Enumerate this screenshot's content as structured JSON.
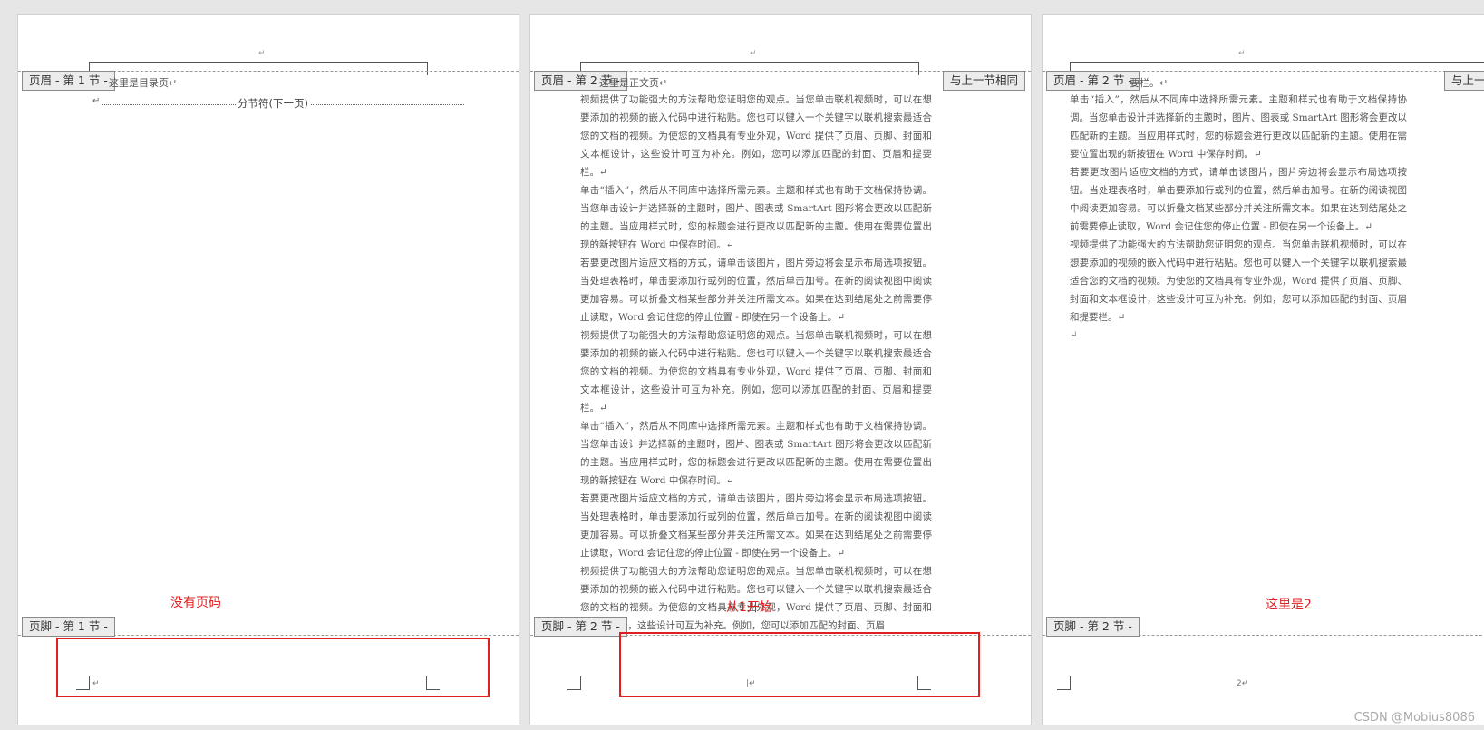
{
  "pages": [
    {
      "header_tag": "页眉 - 第 1 节 -",
      "intro": "这里是目录页↵",
      "section_break": "分节符(下一页)",
      "footer_tag": "页脚 - 第 1 节 -",
      "annotation": "没有页码"
    },
    {
      "header_tag": "页眉 - 第 2 节 -",
      "link_tag": "与上一节相同",
      "intro": "这里是正文页↵",
      "footer_tag": "页脚 - 第 2 节 -",
      "annotation": "从1开始",
      "paragraphs": [
        "视频提供了功能强大的方法帮助您证明您的观点。当您单击联机视频时，可以在想要添加的视频的嵌入代码中进行粘贴。您也可以键入一个关键字以联机搜索最适合您的文档的视频。为使您的文档具有专业外观，Word 提供了页眉、页脚、封面和文本框设计，这些设计可互为补充。例如，您可以添加匹配的封面、页眉和提要栏。↵",
        "单击“插入”，然后从不同库中选择所需元素。主题和样式也有助于文档保持协调。当您单击设计并选择新的主题时，图片、图表或 SmartArt 图形将会更改以匹配新的主题。当应用样式时，您的标题会进行更改以匹配新的主题。使用在需要位置出现的新按钮在 Word 中保存时间。↵",
        "若要更改图片适应文档的方式，请单击该图片，图片旁边将会显示布局选项按钮。当处理表格时，单击要添加行或列的位置，然后单击加号。在新的阅读视图中阅读更加容易。可以折叠文档某些部分并关注所需文本。如果在达到结尾处之前需要停止读取，Word 会记住您的停止位置 - 即使在另一个设备上。↵",
        "视频提供了功能强大的方法帮助您证明您的观点。当您单击联机视频时，可以在想要添加的视频的嵌入代码中进行粘贴。您也可以键入一个关键字以联机搜索最适合您的文档的视频。为使您的文档具有专业外观，Word 提供了页眉、页脚、封面和文本框设计，这些设计可互为补充。例如，您可以添加匹配的封面、页眉和提要栏。↵",
        "单击“插入”，然后从不同库中选择所需元素。主题和样式也有助于文档保持协调。当您单击设计并选择新的主题时，图片、图表或 SmartArt 图形将会更改以匹配新的主题。当应用样式时，您的标题会进行更改以匹配新的主题。使用在需要位置出现的新按钮在 Word 中保存时间。↵",
        "若要更改图片适应文档的方式，请单击该图片，图片旁边将会显示布局选项按钮。当处理表格时，单击要添加行或列的位置，然后单击加号。在新的阅读视图中阅读更加容易。可以折叠文档某些部分并关注所需文本。如果在达到结尾处之前需要停止读取，Word 会记住您的停止位置 - 即使在另一个设备上。↵",
        "视频提供了功能强大的方法帮助您证明您的观点。当您单击联机视频时，可以在想要添加的视频的嵌入代码中进行粘贴。您也可以键入一个关键字以联机搜索最适合您的文档的视频。为使您的文档具有专业外观，Word 提供了页眉、页脚、封面和文本框设计，这些设计可互为补充。例如，您可以添加匹配的封面、页眉"
      ]
    },
    {
      "header_tag": "页眉 - 第 2 节 -",
      "link_tag": "与上一节相同",
      "intro": "要栏。↵",
      "footer_tag": "页脚 - 第 2 节 -",
      "page_number": "2↵",
      "annotation": "这里是2",
      "paragraphs": [
        "单击“插入”，然后从不同库中选择所需元素。主题和样式也有助于文档保持协调。当您单击设计并选择新的主题时，图片、图表或 SmartArt 图形将会更改以匹配新的主题。当应用样式时，您的标题会进行更改以匹配新的主题。使用在需要位置出现的新按钮在 Word 中保存时间。↵",
        "若要更改图片适应文档的方式，请单击该图片，图片旁边将会显示布局选项按钮。当处理表格时，单击要添加行或列的位置，然后单击加号。在新的阅读视图中阅读更加容易。可以折叠文档某些部分并关注所需文本。如果在达到结尾处之前需要停止读取，Word 会记住您的停止位置 - 即使在另一个设备上。↵",
        "视频提供了功能强大的方法帮助您证明您的观点。当您单击联机视频时，可以在想要添加的视频的嵌入代码中进行粘贴。您也可以键入一个关键字以联机搜索最适合您的文档的视频。为使您的文档具有专业外观，Word 提供了页眉、页脚、封面和文本框设计，这些设计可互为补充。例如，您可以添加匹配的封面、页眉和提要栏。↵",
        "↵"
      ]
    }
  ],
  "watermark": "CSDN @Mobius8086",
  "colors": {
    "annotation_red": "#e02020",
    "page_bg": "#ffffff",
    "canvas_bg": "#e6e6e6"
  }
}
